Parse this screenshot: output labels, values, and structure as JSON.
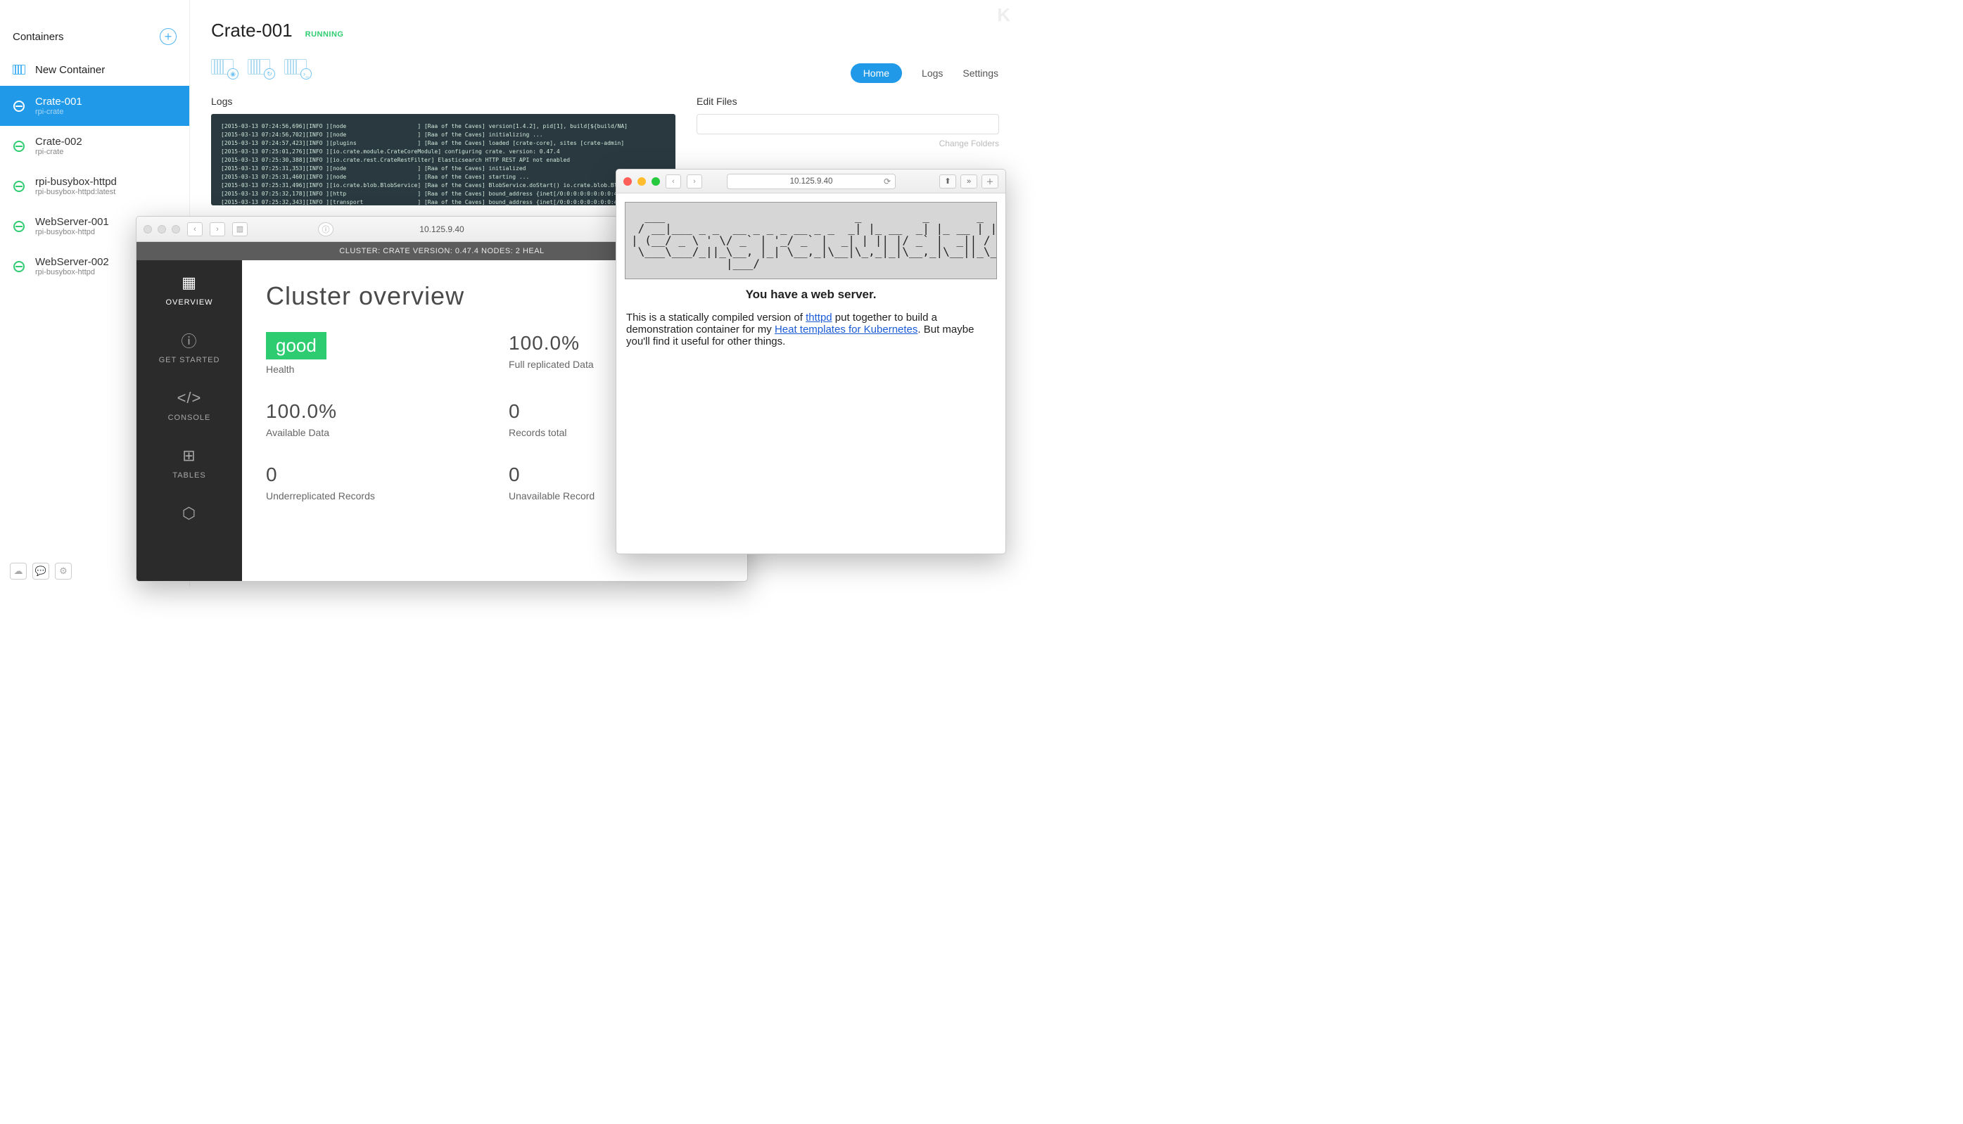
{
  "app": {
    "sidebar_title": "Containers",
    "new_container_label": "New Container",
    "containers": [
      {
        "name": "Crate-001",
        "sub": "rpi-crate",
        "selected": true
      },
      {
        "name": "Crate-002",
        "sub": "rpi-crate",
        "selected": false
      },
      {
        "name": "rpi-busybox-httpd",
        "sub": "rpi-busybox-httpd:latest",
        "selected": false
      },
      {
        "name": "WebServer-001",
        "sub": "rpi-busybox-httpd",
        "selected": false
      },
      {
        "name": "WebServer-002",
        "sub": "rpi-busybox-httpd",
        "selected": false
      }
    ]
  },
  "detail": {
    "title": "Crate-001",
    "status": "RUNNING",
    "tabs": {
      "home": "Home",
      "logs": "Logs",
      "settings": "Settings"
    },
    "logs_label": "Logs",
    "edit_files_label": "Edit Files",
    "change_folders_label": "Change Folders",
    "log_text": "[2015-03-13 07:24:56,696][INFO ][node                     ] [Raa of the Caves] version[1.4.2], pid[1], build[${build/NA]\n[2015-03-13 07:24:56,702][INFO ][node                     ] [Raa of the Caves] initializing ...\n[2015-03-13 07:24:57,423][INFO ][plugins                  ] [Raa of the Caves] loaded [crate-core], sites [crate-admin]\n[2015-03-13 07:25:01,276][INFO ][io.crate.module.CrateCoreModule] configuring crate. version: 0.47.4\n[2015-03-13 07:25:30,388][INFO ][io.crate.rest.CrateRestFilter] Elasticsearch HTTP REST API not enabled\n[2015-03-13 07:25:31,353][INFO ][node                     ] [Raa of the Caves] initialized\n[2015-03-13 07:25:31,460][INFO ][node                     ] [Raa of the Caves] starting ...\n[2015-03-13 07:25:31,496][INFO ][io.crate.blob.BlobService] [Raa of the Caves] BlobService.doStart() io.crate.blob.BlobService@9\n[2015-03-13 07:25:32,178][INFO ][http                     ] [Raa of the Caves] bound_address {inet[/0:0:0:0:0:0:0:0:4200]}, publ\n[2015-03-13 07:25:32,343][INFO ][transport                ] [Raa of the Caves] bound_address {inet[/0:0:0:0:0:0:0:0:4300]}, publ"
  },
  "browser1": {
    "address": "10.125.9.40",
    "header": "CLUSTER:  CRATE       VERSION: 0.47.4       NODES:  2       HEAL",
    "sidenav": [
      {
        "label": "OVERVIEW",
        "active": true
      },
      {
        "label": "GET STARTED",
        "active": false
      },
      {
        "label": "CONSOLE",
        "active": false
      },
      {
        "label": "TABLES",
        "active": false
      }
    ],
    "page_title": "Cluster overview",
    "metrics": {
      "health_value": "good",
      "health_label": "Health",
      "replicated_value": "100.0%",
      "replicated_label": "Full replicated Data",
      "available_value": "100.0%",
      "available_label": "Available Data",
      "records_value": "0",
      "records_label": "Records total",
      "under_value": "0",
      "under_label": "Underreplicated Records",
      "unavail_value": "0",
      "unavail_label": "Unavailable Record"
    }
  },
  "browser2": {
    "address": "10.125.9.40",
    "ascii_art": "  ___                            _         _       _   _      \n / __|___ _ _  __ _ _ _ __ _ _  _| |_ __  _| |_ __ | |_(_)___  \n| (__/ _ \\ ' \\/ _` | '_/ _` |  _| | || |/ _` |  _|| / _ \\ ' \\ \n \\___\\___/_||_\\__, |_| \\__,_|\\__|\\_,_|_|\\__,_|\\__||_\\___/_||_|\n              |___/                                           ",
    "headline": "You have a web server.",
    "body_pre": "This is a statically compiled version of ",
    "link1": "thttpd",
    "body_mid": " put together to build a demonstration container for my ",
    "link2": "Heat templates for Kubernetes",
    "body_post": ". But maybe you'll find it useful for other things."
  },
  "watermark": "K"
}
